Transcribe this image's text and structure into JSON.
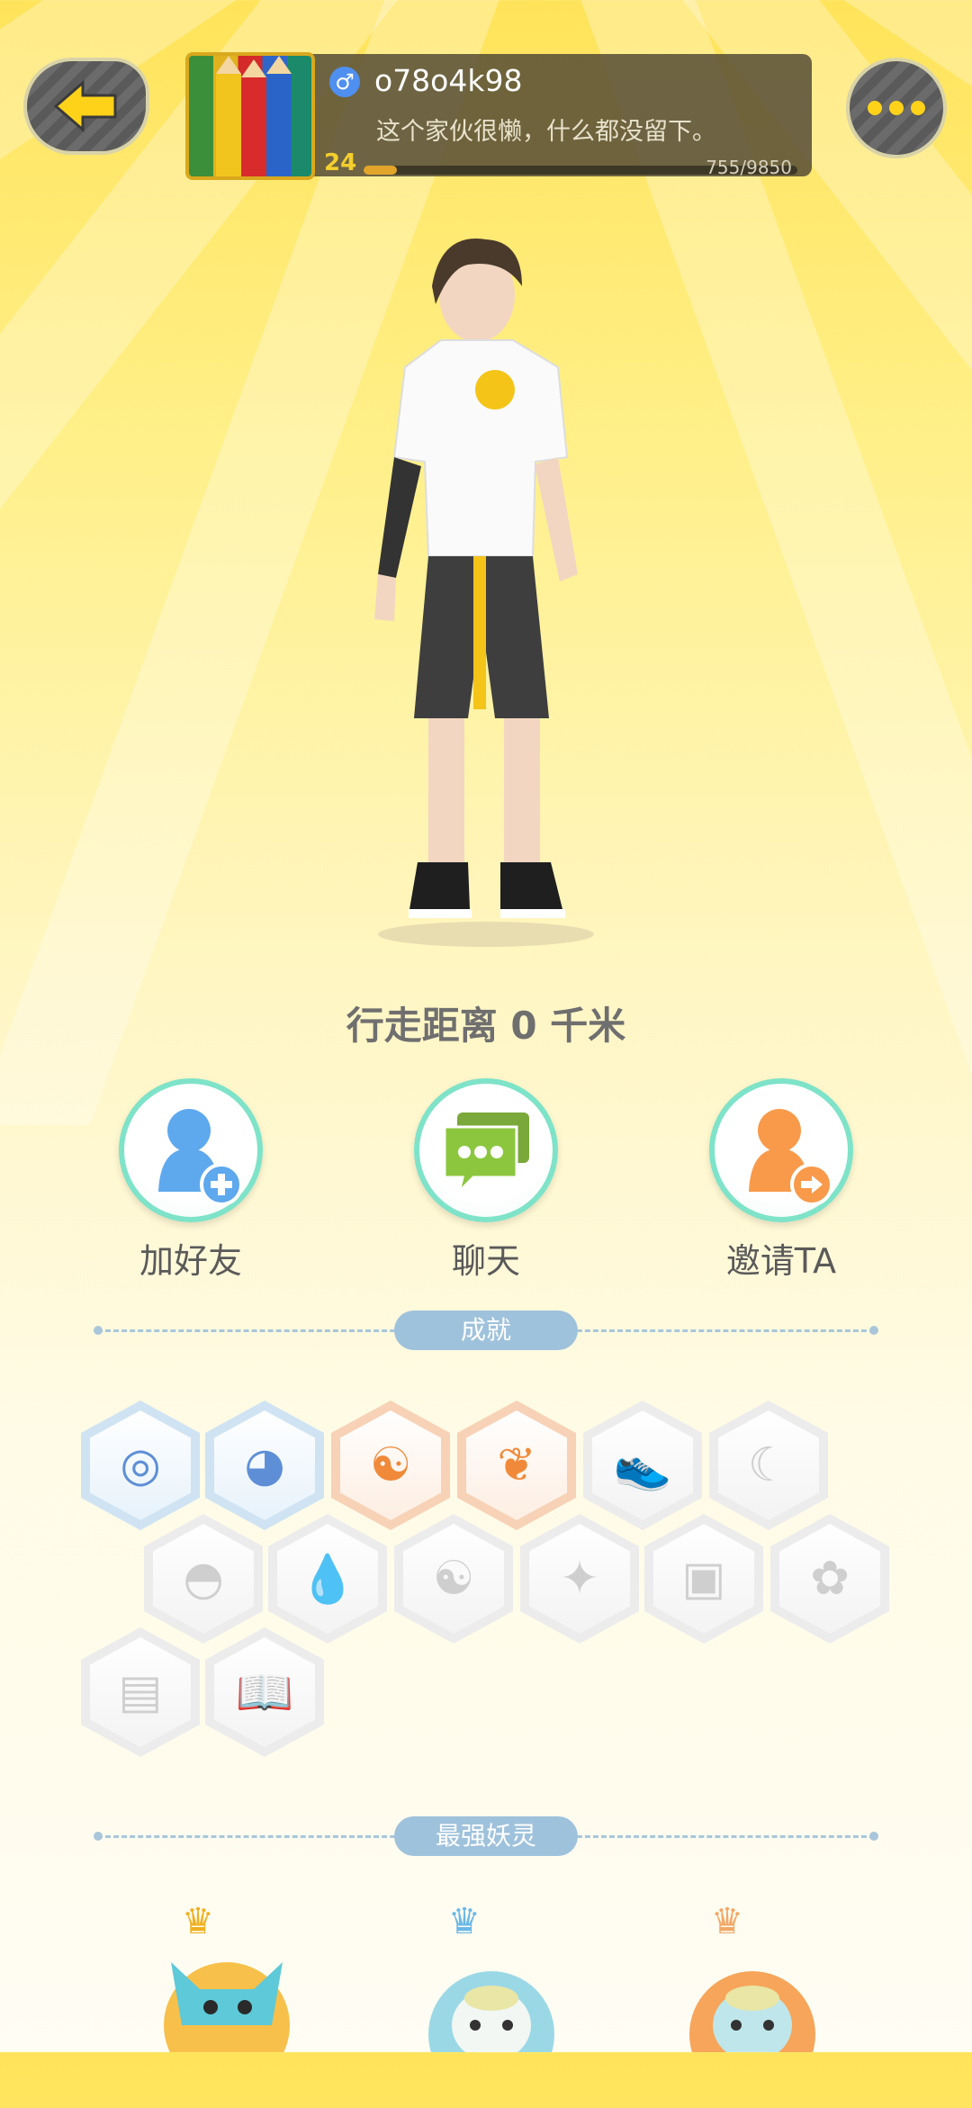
{
  "header": {
    "back_icon": "arrow-left-icon",
    "more_icon": "ellipsis-icon",
    "gender_symbol": "♂",
    "username": "o78o4k98",
    "bio": "这个家伙很懒，什么都没留下。",
    "level": "24",
    "exp_text": "755/9850",
    "exp_fraction": 0.077
  },
  "profile": {
    "walk_distance": "行走距离 0 千米"
  },
  "actions": [
    {
      "label": "加好友",
      "icon": "add-friend-icon"
    },
    {
      "label": "聊天",
      "icon": "chat-icon"
    },
    {
      "label": "邀请TA",
      "icon": "invite-icon"
    }
  ],
  "achievements": {
    "title": "成就",
    "badges": [
      {
        "icon": "portal-icon",
        "state": "unlocked"
      },
      {
        "icon": "cat-ghost-icon",
        "state": "unlocked"
      },
      {
        "icon": "yin-yang-book-icon",
        "state": "unlocked"
      },
      {
        "icon": "koi-fish-icon",
        "state": "unlocked"
      },
      {
        "icon": "sneaker-icon",
        "state": "locked"
      },
      {
        "icon": "moon-icon",
        "state": "locked"
      },
      {
        "icon": "pokeball-icon",
        "state": "locked"
      },
      {
        "icon": "droplet-icon",
        "state": "locked"
      },
      {
        "icon": "yin-yang-icon",
        "state": "locked"
      },
      {
        "icon": "fox-spirit-icon",
        "state": "locked"
      },
      {
        "icon": "robot-cat-icon",
        "state": "locked"
      },
      {
        "icon": "dancing-bear-icon",
        "state": "locked"
      },
      {
        "icon": "scroll-icon",
        "state": "locked"
      },
      {
        "icon": "open-book-icon",
        "state": "locked"
      }
    ]
  },
  "spirits": {
    "title": "最强妖灵",
    "items": [
      {
        "icon": "blue-cat-spirit-icon",
        "crown": "gold"
      },
      {
        "icon": "penguin-spirit-icon",
        "crown": "silver"
      },
      {
        "icon": "penguin-spirit-icon",
        "crown": "bronze"
      }
    ]
  },
  "colors": {
    "accent_yellow": "#ffd21a",
    "action_ring": "#7ee3c8",
    "section_blue": "#9fc2dc"
  }
}
